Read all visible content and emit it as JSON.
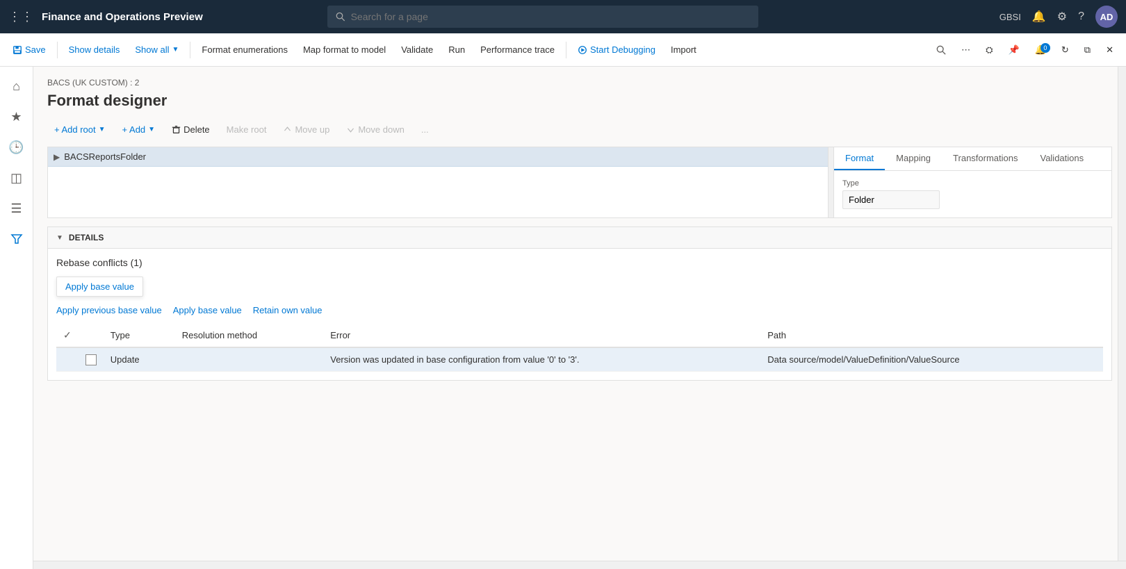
{
  "topNav": {
    "appTitle": "Finance and Operations Preview",
    "searchPlaceholder": "Search for a page",
    "userInitials": "AD",
    "userCode": "GBSI"
  },
  "toolbar": {
    "saveLabel": "Save",
    "showDetailsLabel": "Show details",
    "showAllLabel": "Show all",
    "formatEnumerationsLabel": "Format enumerations",
    "mapFormatToModelLabel": "Map format to model",
    "validateLabel": "Validate",
    "runLabel": "Run",
    "performanceTraceLabel": "Performance trace",
    "startDebuggingLabel": "Start Debugging",
    "importLabel": "Import"
  },
  "breadcrumb": "BACS (UK CUSTOM) : 2",
  "pageTitle": "Format designer",
  "actionBar": {
    "addRootLabel": "+ Add root",
    "addLabel": "+ Add",
    "deleteLabel": "Delete",
    "makeRootLabel": "Make root",
    "moveUpLabel": "Move up",
    "moveDownLabel": "Move down",
    "moreLabel": "..."
  },
  "tabs": {
    "format": "Format",
    "mapping": "Mapping",
    "transformations": "Transformations",
    "validations": "Validations"
  },
  "treeNode": {
    "label": "BACSReportsFolder"
  },
  "rightPanel": {
    "typeLabel": "Type",
    "typeValue": "Folder"
  },
  "details": {
    "sectionLabel": "DETAILS",
    "rebaseTitle": "Rebase conflicts (1)",
    "applyBaseValueLabel": "Apply base value",
    "applyPreviousBaseValueLabel": "Apply previous base value",
    "applyBaseValueActionLabel": "Apply base value",
    "retainOwnValueLabel": "Retain own value"
  },
  "table": {
    "columns": [
      "Resolved",
      "Type",
      "Resolution method",
      "Error",
      "Path"
    ],
    "rows": [
      {
        "resolved": false,
        "type": "Update",
        "resolutionMethod": "",
        "error": "Version was updated in base configuration from value '0' to '3'.",
        "path": "Data source/model/ValueDefinition/ValueSource"
      }
    ]
  }
}
